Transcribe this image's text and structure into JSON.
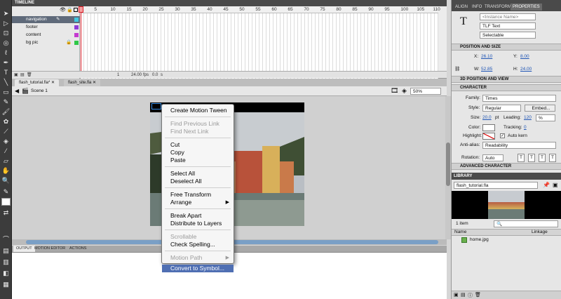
{
  "timeline": {
    "title": "TIMELINE",
    "ruler": [
      "1",
      "5",
      "10",
      "15",
      "20",
      "25",
      "30",
      "35",
      "40",
      "45",
      "50",
      "55",
      "60",
      "65",
      "70",
      "75",
      "80",
      "85",
      "90",
      "95",
      "100",
      "105",
      "110"
    ],
    "layers": [
      {
        "name": "navigation",
        "selected": true
      },
      {
        "name": "footer",
        "selected": false
      },
      {
        "name": "content",
        "selected": false
      },
      {
        "name": "bg pic",
        "selected": false
      }
    ],
    "status": {
      "frame": "1",
      "fps": "24.00",
      "fps_unit": "fps",
      "time": "0.0",
      "time_unit": "s"
    }
  },
  "documents": {
    "tabs": [
      "flash_tutorial.fla*",
      "flash_site.fla"
    ],
    "scene": "Scene 1",
    "zoom": "50%"
  },
  "bottom_tabs": [
    "OUTPUT",
    "MOTION EDITOR",
    "ACTIONS"
  ],
  "context_menu": {
    "items": [
      {
        "label": "Create Motion Tween",
        "disabled": false,
        "submenu": false
      },
      {
        "label": "Find Previous Link",
        "disabled": true,
        "submenu": false
      },
      {
        "label": "Find Next Link",
        "disabled": true,
        "submenu": false
      },
      {
        "label": "Cut",
        "disabled": false,
        "submenu": false
      },
      {
        "label": "Copy",
        "disabled": false,
        "submenu": false
      },
      {
        "label": "Paste",
        "disabled": false,
        "submenu": false
      },
      {
        "label": "Select All",
        "disabled": false,
        "submenu": false
      },
      {
        "label": "Deselect All",
        "disabled": false,
        "submenu": false
      },
      {
        "label": "Free Transform",
        "disabled": false,
        "submenu": false
      },
      {
        "label": "Arrange",
        "disabled": false,
        "submenu": true
      },
      {
        "label": "Break Apart",
        "disabled": false,
        "submenu": false
      },
      {
        "label": "Distribute to Layers",
        "disabled": false,
        "submenu": false
      },
      {
        "label": "Scrollable",
        "disabled": true,
        "submenu": false
      },
      {
        "label": "Check Spelling...",
        "disabled": false,
        "submenu": false
      },
      {
        "label": "Motion Path",
        "disabled": true,
        "submenu": true
      },
      {
        "label": "Convert to Symbol...",
        "disabled": false,
        "submenu": false,
        "highlighted": true
      }
    ]
  },
  "panel_tabs": [
    "ALIGN",
    "INFO",
    "TRANSFORM",
    "PROPERTIES"
  ],
  "properties": {
    "instance_name_placeholder": "<Instance Name>",
    "text_type": "TLF Text",
    "behavior": "Selectable",
    "position": {
      "section": "POSITION AND SIZE",
      "x_label": "X:",
      "x": "26.10",
      "y_label": "Y:",
      "y": "8.00",
      "w_label": "W:",
      "w": "52.85",
      "h_label": "H:",
      "h": "24.00"
    },
    "section_3d": "3D POSITION AND VIEW",
    "character": {
      "section": "CHARACTER",
      "family_label": "Family:",
      "family": "Times",
      "style_label": "Style:",
      "style": "Regular",
      "embed_label": "Embed...",
      "size_label": "Size:",
      "size": "20.0",
      "size_unit": "pt",
      "leading_label": "Leading:",
      "leading": "120",
      "leading_unit": "%",
      "color_label": "Color:",
      "tracking_label": "Tracking:",
      "tracking": "0",
      "highlight_label": "Highlight:",
      "autokern_label": "Auto kern",
      "antialias_label": "Anti-alias:",
      "antialias": "Readability",
      "rotation_label": "Rotation:",
      "rotation": "Auto"
    },
    "section_advanced": "ADVANCED CHARACTER"
  },
  "library": {
    "title": "LIBRARY",
    "file": "flash_tutorial.fla",
    "count": "1 item",
    "col_name": "Name",
    "col_linkage": "Linkage",
    "items": [
      "home.jpg"
    ]
  }
}
